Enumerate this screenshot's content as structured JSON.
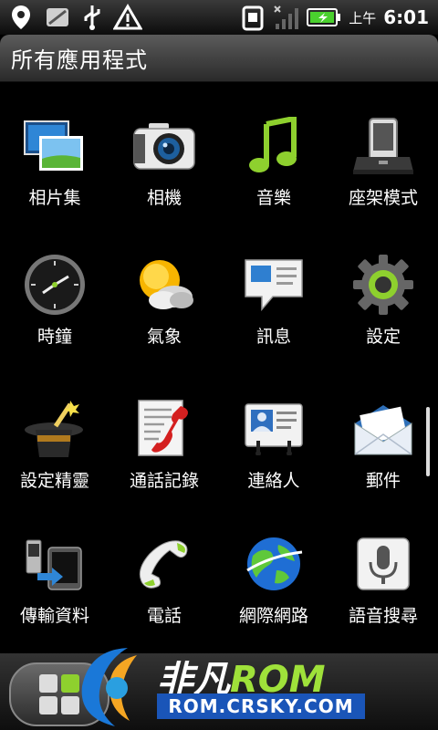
{
  "status_bar": {
    "ampm": "上午",
    "time": "6:01",
    "icons": [
      "location-pin-icon",
      "mail-icon",
      "usb-icon",
      "warning-icon",
      "sim-icon",
      "signal-icon",
      "battery-charging-icon"
    ]
  },
  "header": {
    "title": "所有應用程式"
  },
  "apps": [
    {
      "label": "相片集",
      "icon": "gallery-icon"
    },
    {
      "label": "相機",
      "icon": "camera-icon"
    },
    {
      "label": "音樂",
      "icon": "music-icon"
    },
    {
      "label": "座架模式",
      "icon": "dock-mode-icon"
    },
    {
      "label": "時鐘",
      "icon": "clock-icon"
    },
    {
      "label": "氣象",
      "icon": "weather-icon"
    },
    {
      "label": "訊息",
      "icon": "messages-icon"
    },
    {
      "label": "設定",
      "icon": "settings-gear-icon"
    },
    {
      "label": "設定精靈",
      "icon": "setup-wizard-icon"
    },
    {
      "label": "通話記錄",
      "icon": "call-log-icon"
    },
    {
      "label": "連絡人",
      "icon": "contacts-icon"
    },
    {
      "label": "郵件",
      "icon": "mail-envelope-icon"
    },
    {
      "label": "傳輸資料",
      "icon": "transfer-icon"
    },
    {
      "label": "電話",
      "icon": "phone-icon"
    },
    {
      "label": "網際網路",
      "icon": "globe-icon"
    },
    {
      "label": "語音搜尋",
      "icon": "microphone-icon"
    }
  ],
  "watermark": {
    "brand": "非凡",
    "brand_rom": "ROM",
    "url": "ROM.CRSKY.COM"
  },
  "colors": {
    "accent_green": "#9fe13a",
    "watermark_blue": "#1a55b8"
  }
}
